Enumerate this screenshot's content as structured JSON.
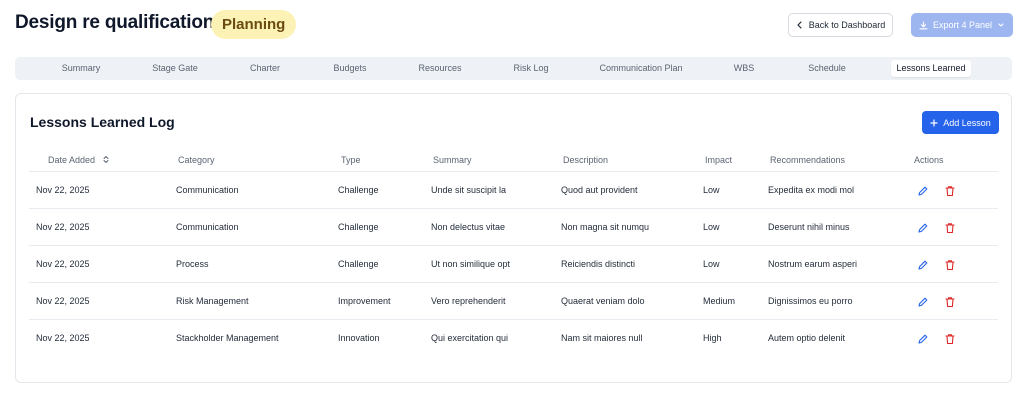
{
  "header": {
    "title": "Design re qualification",
    "status_badge": "Planning",
    "back_label": "Back to Dashboard",
    "export_label": "Export 4 Panel"
  },
  "tabs": [
    {
      "label": "Summary"
    },
    {
      "label": "Stage Gate"
    },
    {
      "label": "Charter"
    },
    {
      "label": "Budgets"
    },
    {
      "label": "Resources"
    },
    {
      "label": "Risk Log"
    },
    {
      "label": "Communication Plan"
    },
    {
      "label": "WBS"
    },
    {
      "label": "Schedule"
    },
    {
      "label": "Lessons Learned",
      "active": true
    }
  ],
  "log": {
    "title": "Lessons Learned Log",
    "add_label": "Add Lesson",
    "columns": [
      "Date Added",
      "Category",
      "Type",
      "Summary",
      "Description",
      "Impact",
      "Recommendations",
      "Actions"
    ],
    "rows": [
      {
        "date": "Nov 22, 2025",
        "category": "Communication",
        "type": "Challenge",
        "summary": "Unde sit suscipit la",
        "description": "Quod aut provident",
        "impact": "Low",
        "recommendations": "Expedita ex modi mol"
      },
      {
        "date": "Nov 22, 2025",
        "category": "Communication",
        "type": "Challenge",
        "summary": "Non delectus vitae",
        "description": "Non magna sit numqu",
        "impact": "Low",
        "recommendations": "Deserunt nihil minus"
      },
      {
        "date": "Nov 22, 2025",
        "category": "Process",
        "type": "Challenge",
        "summary": "Ut non similique opt",
        "description": "Reiciendis distincti",
        "impact": "Low",
        "recommendations": "Nostrum earum asperi"
      },
      {
        "date": "Nov 22, 2025",
        "category": "Risk Management",
        "type": "Improvement",
        "summary": "Vero reprehenderit",
        "description": "Quaerat veniam dolo",
        "impact": "Medium",
        "recommendations": "Dignissimos eu porro"
      },
      {
        "date": "Nov 22, 2025",
        "category": "Stackholder Management",
        "type": "Innovation",
        "summary": "Qui exercitation qui",
        "description": "Nam sit maiores null",
        "impact": "High",
        "recommendations": "Autem optio delenit"
      }
    ]
  },
  "colors": {
    "accent": "#2563eb",
    "badge_bg": "#fdf2b5",
    "edit_icon": "#2563eb",
    "delete_icon": "#dc2626"
  },
  "icons": {
    "back": "chevron-left-icon",
    "export": "download-icon",
    "export_caret": "chevron-down-icon",
    "add": "plus-icon",
    "sort": "sort-icon",
    "edit": "pencil-icon",
    "delete": "trash-icon"
  }
}
